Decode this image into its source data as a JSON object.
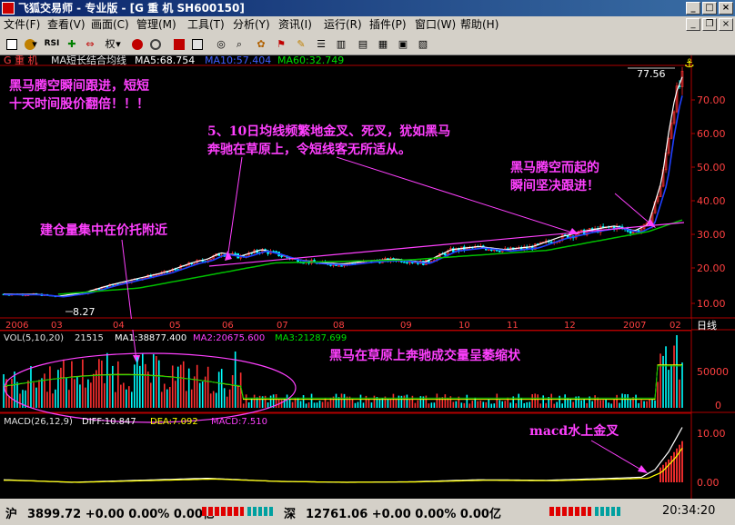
{
  "window": {
    "title": "飞狐交易师 - 专业版 - [G 重  机 SH600150]"
  },
  "menu": {
    "items": [
      "文件(F)",
      "查看(V)",
      "画面(C)",
      "管理(M)",
      "工具(T)",
      "分析(Y)",
      "资讯(I)",
      "运行(R)",
      "插件(P)",
      "窗口(W)",
      "帮助(H)"
    ]
  },
  "toolbar": {
    "rsi_label": "RSI",
    "quan_label": "权"
  },
  "stock": {
    "name": "G 重  机"
  },
  "main_panel": {
    "indicator_name": "MA短长结合均线",
    "ma5_label": "MA5:68.754",
    "ma10_label": "MA10:57.404",
    "ma60_label": "MA60:32.749",
    "max_price_label": "77.56",
    "min_price_label": "8.27",
    "y_ticks": [
      "70.00",
      "60.00",
      "50.00",
      "40.00",
      "30.00",
      "20.00",
      "10.00"
    ],
    "period_label": "日线"
  },
  "time_axis": {
    "labels": [
      "2006",
      "03",
      "04",
      "05",
      "06",
      "07",
      "08",
      "09",
      "10",
      "11",
      "12",
      "2007",
      "02"
    ]
  },
  "annotations": {
    "a1_line1": "黑马腾空瞬间跟进，短短",
    "a1_line2": "十天时间股价翻倍！！！",
    "a2_line1": "5、10日均线频繁地金叉、死叉，犹如黑马",
    "a2_line2": "奔驰在草原上，令短线客无所适从。",
    "a3_line1": "黑马腾空而起的",
    "a3_line2": "瞬间坚决跟进！",
    "a4": "建仓量集中在价托附近",
    "a5": "黑马在草原上奔驰成交量呈萎缩状",
    "a6": "macd水上金叉"
  },
  "volume_panel": {
    "title": "VOL(5,10,20)",
    "value": "21515",
    "ma1": "MA1:38877.400",
    "ma2": "MA2:20675.600",
    "ma3": "MA3:21287.699",
    "y_ticks": [
      "50000",
      "0"
    ]
  },
  "macd_panel": {
    "title": "MACD(26,12,9)",
    "diff": "DIFF:10.847",
    "dea": "DEA:7.092",
    "macd": "MACD:7.510",
    "y_ticks": [
      "10.00",
      "0.00"
    ]
  },
  "status": {
    "sh_label": "沪",
    "sh_quote": "3899.72 +0.00 0.00% 0.00亿",
    "sz_label": "深",
    "sz_quote": "12761.06 +0.00 0.00% 0.00亿",
    "time": "20:34:20"
  },
  "colors": {
    "ma5": "#ffffff",
    "ma10": "#2040ff",
    "ma60": "#00c000",
    "up_candle": "#ff3030",
    "down_candle": "#00ffff",
    "annotation": "#ff40ff",
    "axis": "#b00000"
  },
  "chart_data": {
    "type": "candlestick",
    "y_axis": {
      "min": 0,
      "max": 80
    },
    "price_path": [
      [
        0,
        9.0
      ],
      [
        0.05,
        8.9
      ],
      [
        0.08,
        8.27
      ],
      [
        0.12,
        9.5
      ],
      [
        0.16,
        12
      ],
      [
        0.2,
        14
      ],
      [
        0.24,
        16
      ],
      [
        0.28,
        19
      ],
      [
        0.3,
        20
      ],
      [
        0.32,
        22
      ],
      [
        0.35,
        21
      ],
      [
        0.38,
        23
      ],
      [
        0.4,
        22
      ],
      [
        0.43,
        20
      ],
      [
        0.46,
        19
      ],
      [
        0.5,
        18.5
      ],
      [
        0.54,
        19.5
      ],
      [
        0.58,
        20
      ],
      [
        0.62,
        19
      ],
      [
        0.66,
        23
      ],
      [
        0.7,
        24
      ],
      [
        0.74,
        23
      ],
      [
        0.78,
        24
      ],
      [
        0.82,
        27
      ],
      [
        0.86,
        29
      ],
      [
        0.9,
        30.5
      ],
      [
        0.93,
        29
      ],
      [
        0.95,
        31
      ],
      [
        0.97,
        45
      ],
      [
        0.98,
        60
      ],
      [
        0.99,
        72
      ],
      [
        1.0,
        77.56
      ]
    ],
    "ma60_path": [
      [
        0.08,
        9
      ],
      [
        0.2,
        11
      ],
      [
        0.3,
        15
      ],
      [
        0.4,
        19
      ],
      [
        0.5,
        19.5
      ],
      [
        0.6,
        20
      ],
      [
        0.7,
        21.5
      ],
      [
        0.8,
        23
      ],
      [
        0.9,
        27
      ],
      [
        0.95,
        29
      ],
      [
        1.0,
        32.7
      ]
    ],
    "macd_path": [
      [
        0,
        0.5
      ],
      [
        0.1,
        0
      ],
      [
        0.2,
        0.4
      ],
      [
        0.3,
        0.8
      ],
      [
        0.4,
        0.2
      ],
      [
        0.5,
        0
      ],
      [
        0.6,
        0.1
      ],
      [
        0.7,
        0.5
      ],
      [
        0.8,
        0.4
      ],
      [
        0.9,
        0.8
      ],
      [
        0.94,
        1.0
      ],
      [
        0.96,
        2.5
      ],
      [
        0.98,
        6
      ],
      [
        1.0,
        10.8
      ]
    ]
  }
}
